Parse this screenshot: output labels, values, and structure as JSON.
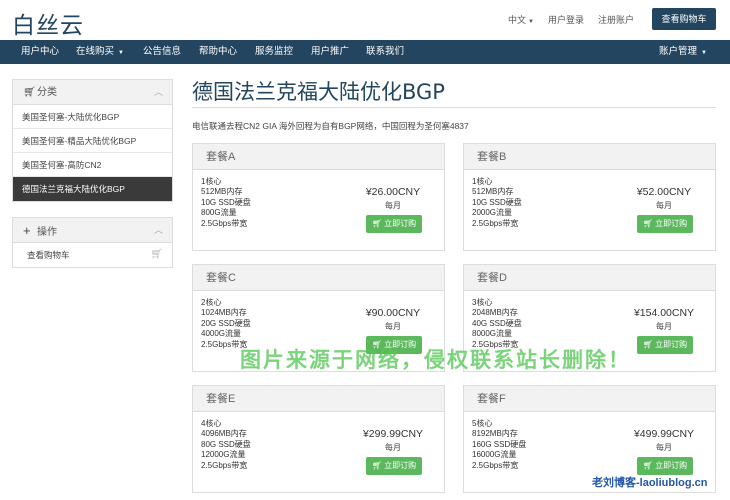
{
  "header": {
    "logo": "白丝云",
    "language": "中文",
    "login": "用户登录",
    "register": "注册账户",
    "cart_button": "查看购物车"
  },
  "nav": {
    "items": [
      "用户中心",
      "在线购买",
      "公告信息",
      "帮助中心",
      "服务监控",
      "用户推广",
      "联系我们"
    ],
    "account": "账户管理"
  },
  "sidebar": {
    "categories_title": "分类",
    "categories": [
      "美国圣何塞-大陆优化BGP",
      "美国圣何塞-精品大陆优化BGP",
      "美国圣何塞-高防CN2",
      "德国法兰克福大陆优化BGP"
    ],
    "actions_title": "操作",
    "actions": [
      "查看购物车"
    ]
  },
  "main": {
    "title": "德国法兰克福大陆优化BGP",
    "subtitle": "电信联通去程CN2 GIA 海外回程为自有BGP网络，中国回程为圣何塞4837",
    "order_label": "立即订购",
    "plans": [
      {
        "name": "套餐A",
        "specs": [
          "1核心",
          "512MB内存",
          "10G SSD硬盘",
          "800G流量",
          "2.5Gbps带宽"
        ],
        "price": "¥26.00CNY",
        "period": "每月"
      },
      {
        "name": "套餐B",
        "specs": [
          "1核心",
          "512MB内存",
          "10G SSD硬盘",
          "2000G流量",
          "2.5Gbps带宽"
        ],
        "price": "¥52.00CNY",
        "period": "每月"
      },
      {
        "name": "套餐C",
        "specs": [
          "2核心",
          "1024MB内存",
          "20G SSD硬盘",
          "4000G流量",
          "2.5Gbps带宽"
        ],
        "price": "¥90.00CNY",
        "period": "每月"
      },
      {
        "name": "套餐D",
        "specs": [
          "3核心",
          "2048MB内存",
          "40G SSD硬盘",
          "8000G流量",
          "2.5Gbps带宽"
        ],
        "price": "¥154.00CNY",
        "period": "每月"
      },
      {
        "name": "套餐E",
        "specs": [
          "4核心",
          "4096MB内存",
          "80G SSD硬盘",
          "12000G流量",
          "2.5Gbps带宽"
        ],
        "price": "¥299.99CNY",
        "period": "每月"
      },
      {
        "name": "套餐F",
        "specs": [
          "5核心",
          "8192MB内存",
          "160G SSD硬盘",
          "16000G流量",
          "2.5Gbps带宽"
        ],
        "price": "¥499.99CNY",
        "period": "每月"
      }
    ]
  },
  "overlay": {
    "watermark": "图片来源于网络，侵权联系站长删除！",
    "corner_mark": "老刘博客-laoliublog.cn"
  },
  "colors": {
    "primary": "#23455f",
    "order_button": "#5cb85c",
    "active_item": "#3a3a3a"
  }
}
